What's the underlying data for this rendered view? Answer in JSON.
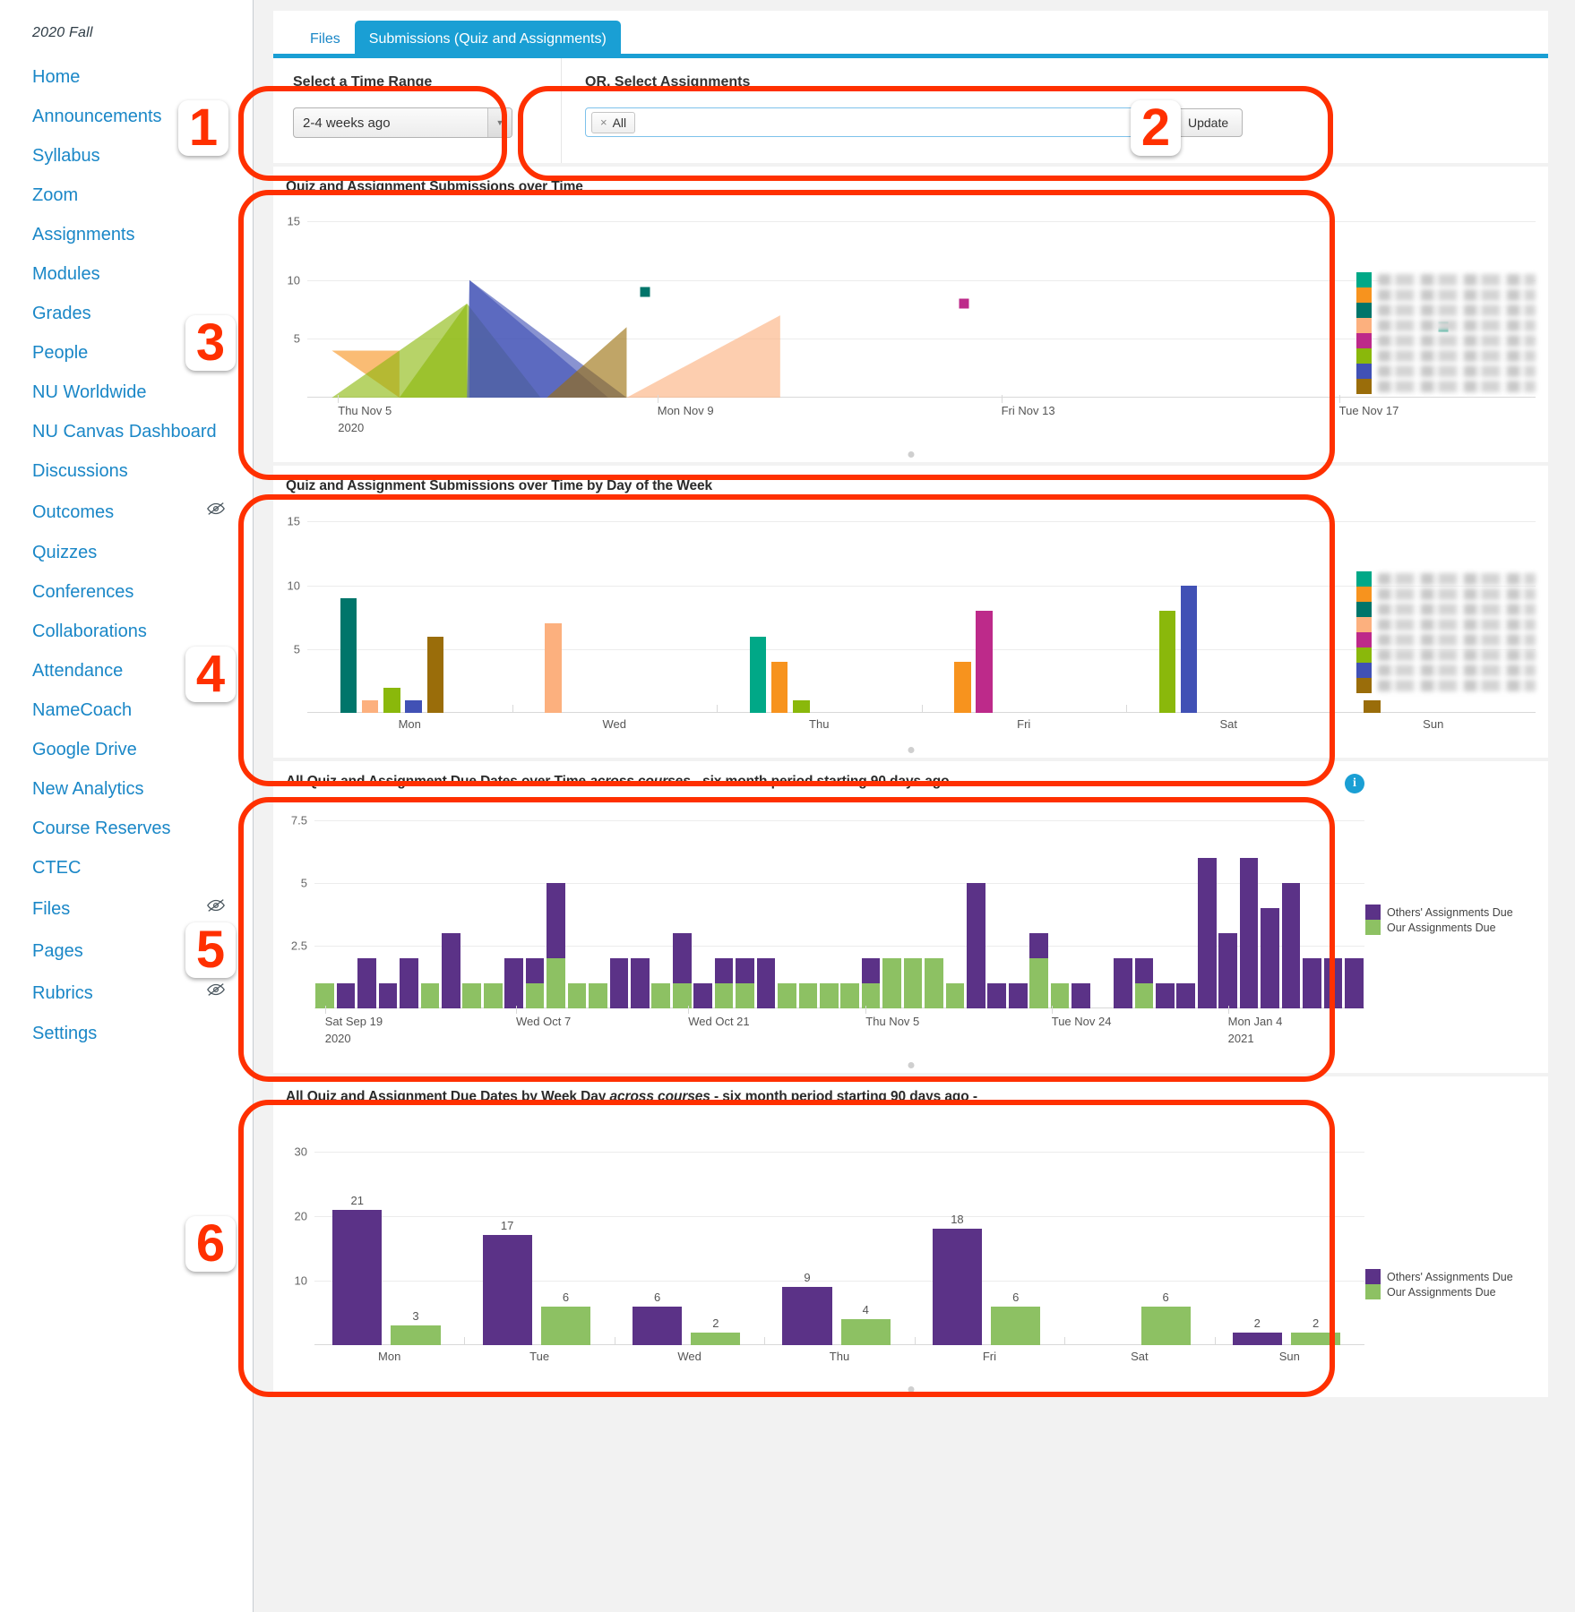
{
  "sidebar": {
    "term": "2020 Fall",
    "items": [
      {
        "label": "Home",
        "hidden": false
      },
      {
        "label": "Announcements",
        "hidden": false
      },
      {
        "label": "Syllabus",
        "hidden": false
      },
      {
        "label": "Zoom",
        "hidden": false
      },
      {
        "label": "Assignments",
        "hidden": false
      },
      {
        "label": "Modules",
        "hidden": false
      },
      {
        "label": "Grades",
        "hidden": false
      },
      {
        "label": "People",
        "hidden": false
      },
      {
        "label": "NU Worldwide",
        "hidden": false
      },
      {
        "label": "NU Canvas Dashboard",
        "hidden": false
      },
      {
        "label": "Discussions",
        "hidden": false
      },
      {
        "label": "Outcomes",
        "hidden": true
      },
      {
        "label": "Quizzes",
        "hidden": false
      },
      {
        "label": "Conferences",
        "hidden": false
      },
      {
        "label": "Collaborations",
        "hidden": false
      },
      {
        "label": "Attendance",
        "hidden": false
      },
      {
        "label": "NameCoach",
        "hidden": false
      },
      {
        "label": "Google Drive",
        "hidden": false
      },
      {
        "label": "New Analytics",
        "hidden": false
      },
      {
        "label": "Course Reserves",
        "hidden": false
      },
      {
        "label": "CTEC",
        "hidden": false
      },
      {
        "label": "Files",
        "hidden": true
      },
      {
        "label": "Pages",
        "hidden": true
      },
      {
        "label": "Rubrics",
        "hidden": true
      },
      {
        "label": "Settings",
        "hidden": false
      }
    ]
  },
  "tabs": [
    {
      "label": "Files",
      "active": false
    },
    {
      "label": "Submissions (Quiz and Assignments)",
      "active": true
    }
  ],
  "controls": {
    "time_range_title": "Select a Time Range",
    "time_range_value": "2-4 weeks ago",
    "time_range_options": [
      "2-4 weeks ago"
    ],
    "assignments_title": "OR, Select Assignments",
    "assignment_token": "All",
    "assignment_token_remove": "×",
    "update_label": "Update"
  },
  "annotations": {
    "badges": [
      "1",
      "2",
      "3",
      "4",
      "5",
      "6"
    ]
  },
  "series_palette": [
    "#00a887",
    "#f7931e",
    "#00756a",
    "#fcb07e",
    "#bd2a8a",
    "#8ab80b",
    "#4151b5",
    "#9a6d0a"
  ],
  "due_palette": {
    "others": "#5b3287",
    "ours": "#8dc163"
  },
  "chart_data": [
    {
      "id": "submissions-over-time",
      "type": "area",
      "title": "Quiz and Assignment Submissions over Time",
      "xlabel": "",
      "ylabel": "",
      "ylim": [
        0,
        16
      ],
      "yticks": [
        5,
        10,
        15
      ],
      "grid": true,
      "legend_position": "right",
      "legend_entries": [
        {
          "color": "#00a887",
          "label": "(blurred)"
        },
        {
          "color": "#f7931e",
          "label": "(blurred)"
        },
        {
          "color": "#00756a",
          "label": "(blurred)"
        },
        {
          "color": "#fcb07e",
          "label": "(blurred)"
        },
        {
          "color": "#bd2a8a",
          "label": "(blurred)"
        },
        {
          "color": "#8ab80b",
          "label": "(blurred)"
        },
        {
          "color": "#4151b5",
          "label": "(blurred)"
        },
        {
          "color": "#9a6d0a",
          "label": "(blurred)"
        }
      ],
      "xtick_labels": [
        "Thu Nov 5\n2020",
        "Mon Nov 9",
        "Fri Nov 13",
        "Tue Nov 17"
      ],
      "xtick_positions_pct": [
        2.5,
        28.5,
        56.5,
        84.0
      ],
      "series": [
        {
          "name": "series-orange",
          "color": "#f7931e",
          "shape": "area",
          "points": [
            {
              "x": 2.0,
              "y": 4
            },
            {
              "x": 7.5,
              "y": 4
            },
            {
              "x": 7.5,
              "y": 0
            }
          ]
        },
        {
          "name": "series-yellowgreen",
          "color": "#8ab80b",
          "shape": "area",
          "points": [
            {
              "x": 2.0,
              "y": 0
            },
            {
              "x": 13.0,
              "y": 8
            },
            {
              "x": 13.0,
              "y": 0
            }
          ]
        },
        {
          "name": "series-lightgreen",
          "color": "#8ab80b",
          "shape": "area",
          "points": [
            {
              "x": 7.5,
              "y": 0
            },
            {
              "x": 13.0,
              "y": 8
            },
            {
              "x": 19.0,
              "y": 0
            }
          ]
        },
        {
          "name": "series-blue",
          "color": "#4151b5",
          "shape": "area",
          "points": [
            {
              "x": 13.0,
              "y": 0
            },
            {
              "x": 13.2,
              "y": 10
            },
            {
              "x": 24.5,
              "y": 0
            }
          ]
        },
        {
          "name": "series-steel",
          "color": "#4151b5",
          "shape": "area",
          "points": [
            {
              "x": 13.2,
              "y": 10
            },
            {
              "x": 26.0,
              "y": 0
            },
            {
              "x": 13.2,
              "y": 0
            }
          ]
        },
        {
          "name": "series-brown",
          "color": "#9a6d0a",
          "shape": "area",
          "points": [
            {
              "x": 19.5,
              "y": 0
            },
            {
              "x": 26.0,
              "y": 6
            },
            {
              "x": 26.0,
              "y": 0
            }
          ]
        },
        {
          "name": "series-peach",
          "color": "#fcb07e",
          "shape": "area",
          "points": [
            {
              "x": 26.0,
              "y": 0
            },
            {
              "x": 38.5,
              "y": 7
            },
            {
              "x": 38.5,
              "y": 0
            }
          ]
        },
        {
          "name": "point-darkteal",
          "color": "#00756a",
          "shape": "point",
          "points": [
            {
              "x": 27.5,
              "y": 9
            }
          ]
        },
        {
          "name": "point-magenta",
          "color": "#bd2a8a",
          "shape": "point",
          "points": [
            {
              "x": 53.5,
              "y": 8
            }
          ]
        },
        {
          "name": "point-teal",
          "color": "#00a887",
          "shape": "point",
          "points": [
            {
              "x": 92.5,
              "y": 6
            }
          ]
        }
      ]
    },
    {
      "id": "submissions-by-day-of-week",
      "type": "bar",
      "title": "Quiz and Assignment Submissions over Time by Day of the Week",
      "xlabel": "",
      "ylabel": "",
      "ylim": [
        0,
        16
      ],
      "yticks": [
        5,
        10,
        15
      ],
      "grid": true,
      "legend_position": "right",
      "legend_entries": [
        {
          "color": "#00a887",
          "label": "(blurred)"
        },
        {
          "color": "#f7931e",
          "label": "(blurred)"
        },
        {
          "color": "#00756a",
          "label": "(blurred)"
        },
        {
          "color": "#fcb07e",
          "label": "(blurred)"
        },
        {
          "color": "#bd2a8a",
          "label": "(blurred)"
        },
        {
          "color": "#8ab80b",
          "label": "(blurred)"
        },
        {
          "color": "#4151b5",
          "label": "(blurred)"
        },
        {
          "color": "#9a6d0a",
          "label": "(blurred)"
        }
      ],
      "categories": [
        "Mon",
        "Wed",
        "Thu",
        "Fri",
        "Sat",
        "Sun"
      ],
      "bars": [
        {
          "category": "Mon",
          "color": "#00756a",
          "value": 9
        },
        {
          "category": "Mon",
          "color": "#fcb07e",
          "value": 1
        },
        {
          "category": "Mon",
          "color": "#8ab80b",
          "value": 2
        },
        {
          "category": "Mon",
          "color": "#4151b5",
          "value": 1
        },
        {
          "category": "Mon",
          "color": "#9a6d0a",
          "value": 6
        },
        {
          "category": "Wed",
          "color": "#fcb07e",
          "value": 7
        },
        {
          "category": "Thu",
          "color": "#00a887",
          "value": 6
        },
        {
          "category": "Thu",
          "color": "#f7931e",
          "value": 4
        },
        {
          "category": "Thu",
          "color": "#8ab80b",
          "value": 1
        },
        {
          "category": "Fri",
          "color": "#f7931e",
          "value": 4
        },
        {
          "category": "Fri",
          "color": "#bd2a8a",
          "value": 8
        },
        {
          "category": "Sat",
          "color": "#8ab80b",
          "value": 8
        },
        {
          "category": "Sat",
          "color": "#4151b5",
          "value": 10
        },
        {
          "category": "Sun",
          "color": "#9a6d0a",
          "value": 1
        }
      ]
    },
    {
      "id": "due-dates-over-time",
      "type": "bar",
      "title_main": "All Quiz and Assignment Due Dates over Time ",
      "title_italic": "across courses",
      "title_tail": " - six month period starting 90 days ago -",
      "info_icon": "info-icon",
      "ylim": [
        0,
        8
      ],
      "yticks": [
        2.5,
        5,
        7.5
      ],
      "grid": true,
      "legend_position": "right",
      "legend_entries": [
        {
          "color": "#5b3287",
          "label": "Others' Assignments Due"
        },
        {
          "color": "#8dc163",
          "label": "Our Assignments Due"
        }
      ],
      "xtick_labels": [
        "Sat Sep 19\n2020",
        "Wed Oct 7",
        "Wed Oct 21",
        "Thu Nov 5",
        "Tue Nov 24",
        "Mon Jan 4\n2021"
      ],
      "xtick_positions_pct": [
        1.0,
        19.2,
        35.6,
        52.5,
        70.2,
        87.0
      ],
      "stacked_bars": [
        {
          "ours": 1,
          "others": 0
        },
        {
          "ours": 0,
          "others": 1
        },
        {
          "ours": 0,
          "others": 2
        },
        {
          "ours": 0,
          "others": 1
        },
        {
          "ours": 0,
          "others": 2
        },
        {
          "ours": 1,
          "others": 0
        },
        {
          "ours": 0,
          "others": 3
        },
        {
          "ours": 1,
          "others": 0
        },
        {
          "ours": 1,
          "others": 0
        },
        {
          "ours": 0,
          "others": 2
        },
        {
          "ours": 1,
          "others": 1
        },
        {
          "ours": 2,
          "others": 3
        },
        {
          "ours": 1,
          "others": 0
        },
        {
          "ours": 1,
          "others": 0
        },
        {
          "ours": 0,
          "others": 2
        },
        {
          "ours": 0,
          "others": 2
        },
        {
          "ours": 1,
          "others": 0
        },
        {
          "ours": 1,
          "others": 2
        },
        {
          "ours": 0,
          "others": 1
        },
        {
          "ours": 1,
          "others": 1
        },
        {
          "ours": 1,
          "others": 1
        },
        {
          "ours": 0,
          "others": 2
        },
        {
          "ours": 1,
          "others": 0
        },
        {
          "ours": 1,
          "others": 0
        },
        {
          "ours": 1,
          "others": 0
        },
        {
          "ours": 1,
          "others": 0
        },
        {
          "ours": 1,
          "others": 1
        },
        {
          "ours": 2,
          "others": 0
        },
        {
          "ours": 2,
          "others": 0
        },
        {
          "ours": 2,
          "others": 0
        },
        {
          "ours": 1,
          "others": 0
        },
        {
          "ours": 0,
          "others": 5
        },
        {
          "ours": 0,
          "others": 1
        },
        {
          "ours": 0,
          "others": 1
        },
        {
          "ours": 2,
          "others": 1
        },
        {
          "ours": 1,
          "others": 0
        },
        {
          "ours": 0,
          "others": 1
        },
        {
          "ours": 0,
          "others": 0
        },
        {
          "ours": 0,
          "others": 2
        },
        {
          "ours": 1,
          "others": 1
        },
        {
          "ours": 0,
          "others": 1
        },
        {
          "ours": 0,
          "others": 1
        },
        {
          "ours": 0,
          "others": 6
        },
        {
          "ours": 0,
          "others": 3
        },
        {
          "ours": 0,
          "others": 6
        },
        {
          "ours": 0,
          "others": 4
        },
        {
          "ours": 0,
          "others": 5
        },
        {
          "ours": 0,
          "others": 2
        },
        {
          "ours": 0,
          "others": 2
        },
        {
          "ours": 0,
          "others": 2
        }
      ]
    },
    {
      "id": "due-dates-by-week-day",
      "type": "bar",
      "title_main": "All Quiz and Assignment Due Dates by Week Day ",
      "title_italic": "across courses",
      "title_tail": " - six month period starting 90 days ago -",
      "ylim": [
        0,
        33
      ],
      "yticks": [
        10,
        20,
        30
      ],
      "grid": true,
      "legend_position": "right",
      "legend_entries": [
        {
          "color": "#5b3287",
          "label": "Others' Assignments Due"
        },
        {
          "color": "#8dc163",
          "label": "Our Assignments Due"
        }
      ],
      "categories": [
        "Mon",
        "Tue",
        "Wed",
        "Thu",
        "Fri",
        "Sat",
        "Sun"
      ],
      "series": [
        {
          "name": "Others' Assignments Due",
          "color": "#5b3287",
          "values": [
            21,
            17,
            6,
            9,
            18,
            null,
            2
          ]
        },
        {
          "name": "Our Assignments Due",
          "color": "#8dc163",
          "values": [
            3,
            6,
            2,
            4,
            6,
            6,
            2
          ]
        }
      ]
    }
  ]
}
